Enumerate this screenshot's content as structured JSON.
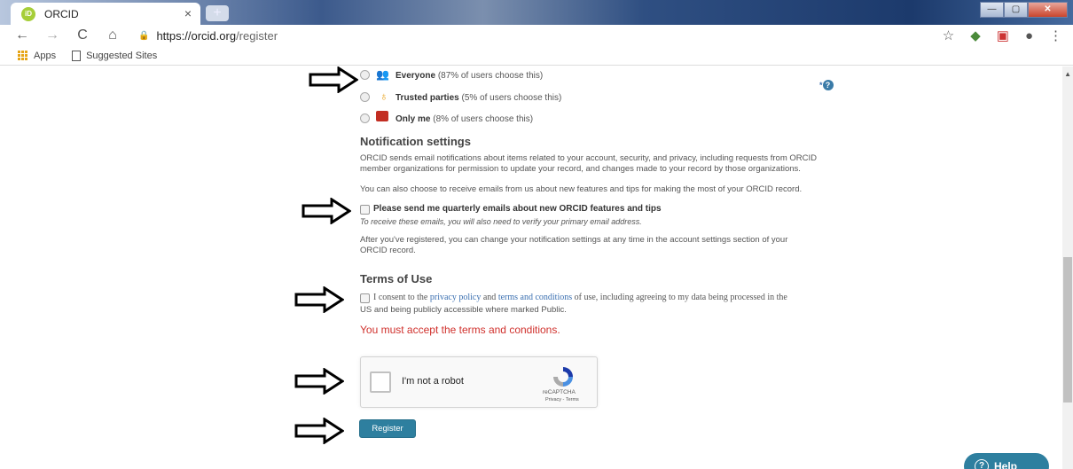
{
  "browser": {
    "tab_title": "ORCID",
    "favicon_text": "iD",
    "url_host": "https://orcid.org",
    "url_path": "/register",
    "bookmarks": [
      {
        "label": "Apps",
        "icon": "apps-grid-icon"
      },
      {
        "label": "Suggested Sites",
        "icon": "page-icon"
      }
    ]
  },
  "visibility": {
    "options": [
      {
        "label": "Everyone",
        "note": "(87% of users choose this)",
        "icon": "people-icon",
        "color": "#3c9a2c"
      },
      {
        "label": "Trusted parties",
        "note": "(5% of users choose this)",
        "icon": "key-icon",
        "color": "#e8a017"
      },
      {
        "label": "Only me",
        "note": "(8% of users choose this)",
        "icon": "lock-icon",
        "color": "#c22d22"
      }
    ],
    "help_marker": "*"
  },
  "notifications": {
    "heading": "Notification settings",
    "para1_line1": "ORCID sends email notifications about items related to your account, security, and privacy, including requests from ORCID",
    "para1_line2": "member organizations for permission to update your record, and changes made to your record by those organizations.",
    "para2": "You can also choose to receive emails from us about new features and tips for making the most of your ORCID record.",
    "checkbox_label": "Please send me quarterly emails about new ORCID features and tips",
    "checkbox_hint": "To receive these emails, you will also need to verify your primary email address.",
    "para3_line1": "After you've registered, you can change your notification settings at any time in the account settings section of your",
    "para3_line2": "ORCID record."
  },
  "terms": {
    "heading": "Terms of Use",
    "consent_prefix": "I consent to the ",
    "privacy_link": "privacy policy",
    "and": " and ",
    "terms_link": "terms and conditions",
    "consent_suffix": " of use, including agreeing to my data being processed in the",
    "consent_line2": "US and being publicly accessible where marked Public.",
    "error": "You must accept the terms and conditions."
  },
  "captcha": {
    "label": "I'm not a robot",
    "brand": "reCAPTCHA",
    "links": "Privacy - Terms"
  },
  "register_label": "Register",
  "help_label": "Help",
  "colors": {
    "accent": "#2e7f9f",
    "error": "#d0312d",
    "link": "#3a6fb0"
  }
}
